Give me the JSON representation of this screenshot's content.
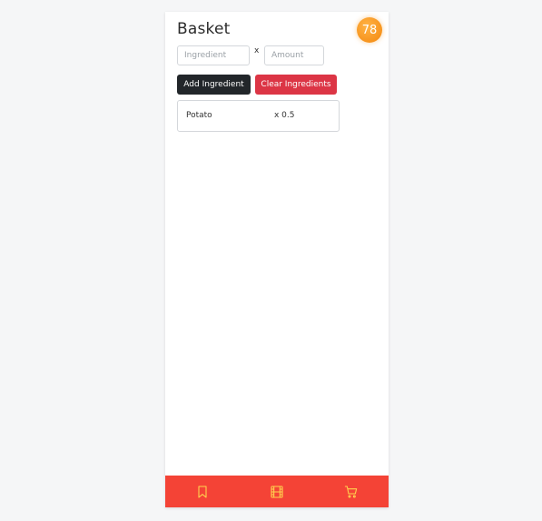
{
  "header": {
    "title": "Basket",
    "badge_count": "78"
  },
  "form": {
    "ingredient_placeholder": "Ingredient",
    "ingredient_value": "",
    "times_label": "x",
    "amount_placeholder": "Amount",
    "amount_value": "",
    "add_label": "Add Ingredient",
    "clear_label": "Clear Ingredients"
  },
  "ingredients": [
    {
      "name": "Potato",
      "amount": "x 0.5"
    }
  ],
  "nav": {
    "items": [
      {
        "icon": "bookmark-icon"
      },
      {
        "icon": "film-icon"
      },
      {
        "icon": "cart-icon"
      }
    ]
  },
  "colors": {
    "badge": "#f7941d",
    "add_button": "#22262a",
    "clear_button": "#dc3545",
    "nav_bar": "#f44336",
    "nav_icon": "#ffd54f"
  }
}
